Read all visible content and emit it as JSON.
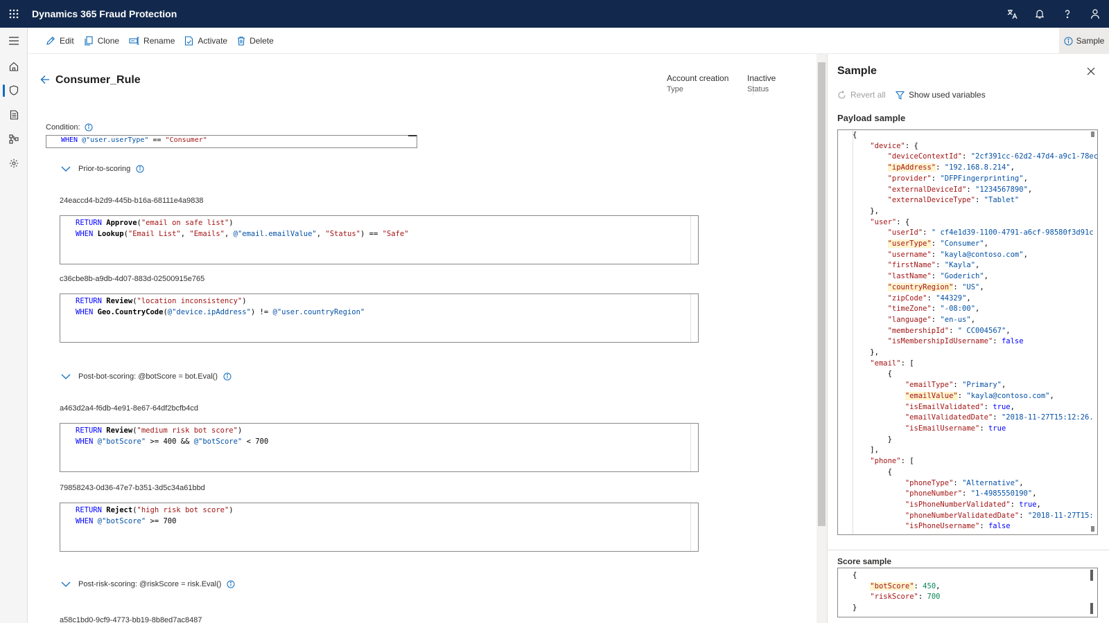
{
  "app": {
    "title": "Dynamics 365 Fraud Protection"
  },
  "topbar": {
    "icons": [
      "waffle-icon",
      "translate-icon",
      "bell-icon",
      "help-icon",
      "person-icon"
    ]
  },
  "leftnav": {
    "icons": [
      "hamburger-icon",
      "home-icon",
      "shield-icon",
      "document-icon",
      "flow-icon",
      "gear-icon"
    ]
  },
  "toolbar": {
    "edit": "Edit",
    "clone": "Clone",
    "rename": "Rename",
    "activate": "Activate",
    "delete": "Delete",
    "sample": "Sample"
  },
  "rule": {
    "name": "Consumer_Rule",
    "type_value": "Account creation",
    "type_label": "Type",
    "status_value": "Inactive",
    "status_label": "Status",
    "condition_label": "Condition:",
    "condition": {
      "kw": "WHEN",
      "var": "@\"user.userType\"",
      "op": " == ",
      "str": "\"Consumer\""
    }
  },
  "sections": [
    {
      "title": "Prior-to-scoring",
      "clauses": [
        {
          "id": "24eaccd4-b2d9-445b-b16a-68111e4a9838",
          "l1": {
            "kw": "RETURN",
            "fn": "Approve",
            "open": "(",
            "str": "\"email on safe list\"",
            "close": ")"
          },
          "l2": {
            "kw": "WHEN",
            "fn": "Lookup",
            "a": "(",
            "s1": "\"Email List\"",
            "c1": ", ",
            "s2": "\"Emails\"",
            "c2": ", ",
            "v1": "@\"email.emailValue\"",
            "c3": ", ",
            "s3": "\"Status\"",
            "c4": ") == ",
            "s4": "\"Safe\""
          }
        },
        {
          "id": "c36cbe8b-a9db-4d07-883d-02500915e765",
          "l1": {
            "kw": "RETURN",
            "fn": "Review",
            "open": "(",
            "str": "\"location inconsistency\"",
            "close": ")"
          },
          "l2": {
            "kw": "WHEN",
            "fn": "Geo.CountryCode",
            "a": "(",
            "v1": "@\"device.ipAddress\"",
            "c1": ") != ",
            "v2": "@\"user.countryRegion\""
          }
        }
      ]
    },
    {
      "title": "Post-bot-scoring: @botScore = bot.Eval()",
      "clauses": [
        {
          "id": "a463d2a4-f6db-4e91-8e67-64df2bcfb4cd",
          "l1": {
            "kw": "RETURN",
            "fn": "Review",
            "open": "(",
            "str": "\"medium risk bot score\"",
            "close": ")"
          },
          "l2": {
            "kw": "WHEN",
            "v1": "@\"botScore\"",
            "c1": " >= 400 && ",
            "v2": "@\"botScore\"",
            "c2": " < 700"
          }
        },
        {
          "id": "79858243-0d36-47e7-b351-3d5c34a61bbd",
          "l1": {
            "kw": "RETURN",
            "fn": "Reject",
            "open": "(",
            "str": "\"high risk bot score\"",
            "close": ")"
          },
          "l2": {
            "kw": "WHEN",
            "v1": "@\"botScore\"",
            "c1": " >= 700"
          }
        }
      ]
    },
    {
      "title": "Post-risk-scoring: @riskScore = risk.Eval()",
      "clauses": [
        {
          "id": "a58c1bd0-9cf9-4773-bb19-8b8ed7ac8487"
        }
      ]
    }
  ],
  "panel": {
    "title": "Sample",
    "revert_all": "Revert all",
    "show_used_variables": "Show used variables",
    "payload_label": "Payload sample",
    "score_label": "Score sample",
    "payload_lines": [
      [
        [
          "p",
          "{"
        ]
      ],
      [
        [
          "p",
          "    "
        ],
        [
          "k",
          "\"device\""
        ],
        [
          "p",
          ": {"
        ]
      ],
      [
        [
          "p",
          "        "
        ],
        [
          "k",
          "\"deviceContextId\""
        ],
        [
          "p",
          ": "
        ],
        [
          "s",
          "\"2cf391cc-62d2-47d4-a9c1-78ec"
        ]
      ],
      [
        [
          "p",
          "        "
        ],
        [
          "k",
          "\"ipAddress\"",
          "hl"
        ],
        [
          "p",
          ": "
        ],
        [
          "s",
          "\"192.168.8.214\""
        ],
        [
          "p",
          ","
        ]
      ],
      [
        [
          "p",
          "        "
        ],
        [
          "k",
          "\"provider\""
        ],
        [
          "p",
          ": "
        ],
        [
          "s",
          "\"DFPFingerprinting\""
        ],
        [
          "p",
          ","
        ]
      ],
      [
        [
          "p",
          "        "
        ],
        [
          "k",
          "\"externalDeviceId\""
        ],
        [
          "p",
          ": "
        ],
        [
          "s",
          "\"1234567890\""
        ],
        [
          "p",
          ","
        ]
      ],
      [
        [
          "p",
          "        "
        ],
        [
          "k",
          "\"externalDeviceType\""
        ],
        [
          "p",
          ": "
        ],
        [
          "s",
          "\"Tablet\""
        ]
      ],
      [
        [
          "p",
          "    },"
        ]
      ],
      [
        [
          "p",
          "    "
        ],
        [
          "k",
          "\"user\""
        ],
        [
          "p",
          ": {"
        ]
      ],
      [
        [
          "p",
          "        "
        ],
        [
          "k",
          "\"userId\""
        ],
        [
          "p",
          ": "
        ],
        [
          "s",
          "\" cf4e1d39-1100-4791-a6cf-98580f3d91c"
        ]
      ],
      [
        [
          "p",
          "        "
        ],
        [
          "k",
          "\"userType\"",
          "hl"
        ],
        [
          "p",
          ": "
        ],
        [
          "s",
          "\"Consumer\""
        ],
        [
          "p",
          ","
        ]
      ],
      [
        [
          "p",
          "        "
        ],
        [
          "k",
          "\"username\""
        ],
        [
          "p",
          ": "
        ],
        [
          "s",
          "\"kayla@contoso.com\""
        ],
        [
          "p",
          ","
        ]
      ],
      [
        [
          "p",
          "        "
        ],
        [
          "k",
          "\"firstName\""
        ],
        [
          "p",
          ": "
        ],
        [
          "s",
          "\"Kayla\""
        ],
        [
          "p",
          ","
        ]
      ],
      [
        [
          "p",
          "        "
        ],
        [
          "k",
          "\"lastName\""
        ],
        [
          "p",
          ": "
        ],
        [
          "s",
          "\"Goderich\""
        ],
        [
          "p",
          ","
        ]
      ],
      [
        [
          "p",
          "        "
        ],
        [
          "k",
          "\"countryRegion\"",
          "hl"
        ],
        [
          "p",
          ": "
        ],
        [
          "s",
          "\"US\""
        ],
        [
          "p",
          ","
        ]
      ],
      [
        [
          "p",
          "        "
        ],
        [
          "k",
          "\"zipCode\""
        ],
        [
          "p",
          ": "
        ],
        [
          "s",
          "\"44329\""
        ],
        [
          "p",
          ","
        ]
      ],
      [
        [
          "p",
          "        "
        ],
        [
          "k",
          "\"timeZone\""
        ],
        [
          "p",
          ": "
        ],
        [
          "s",
          "\"-08:00\""
        ],
        [
          "p",
          ","
        ]
      ],
      [
        [
          "p",
          "        "
        ],
        [
          "k",
          "\"language\""
        ],
        [
          "p",
          ": "
        ],
        [
          "s",
          "\"en-us\""
        ],
        [
          "p",
          ","
        ]
      ],
      [
        [
          "p",
          "        "
        ],
        [
          "k",
          "\"membershipId\""
        ],
        [
          "p",
          ": "
        ],
        [
          "s",
          "\" CC004567\""
        ],
        [
          "p",
          ","
        ]
      ],
      [
        [
          "p",
          "        "
        ],
        [
          "k",
          "\"isMembershipIdUsername\""
        ],
        [
          "p",
          ": "
        ],
        [
          "b",
          "false"
        ]
      ],
      [
        [
          "p",
          "    },"
        ]
      ],
      [
        [
          "p",
          "    "
        ],
        [
          "k",
          "\"email\""
        ],
        [
          "p",
          ": ["
        ]
      ],
      [
        [
          "p",
          "        {"
        ]
      ],
      [
        [
          "p",
          "            "
        ],
        [
          "k",
          "\"emailType\""
        ],
        [
          "p",
          ": "
        ],
        [
          "s",
          "\"Primary\""
        ],
        [
          "p",
          ","
        ]
      ],
      [
        [
          "p",
          "            "
        ],
        [
          "k",
          "\"emailValue\"",
          "hl"
        ],
        [
          "p",
          ": "
        ],
        [
          "s",
          "\"kayla@contoso.com\""
        ],
        [
          "p",
          ","
        ]
      ],
      [
        [
          "p",
          "            "
        ],
        [
          "k",
          "\"isEmailValidated\""
        ],
        [
          "p",
          ": "
        ],
        [
          "b",
          "true"
        ],
        [
          "p",
          ","
        ]
      ],
      [
        [
          "p",
          "            "
        ],
        [
          "k",
          "\"emailValidatedDate\""
        ],
        [
          "p",
          ": "
        ],
        [
          "s",
          "\"2018-11-27T15:12:26."
        ]
      ],
      [
        [
          "p",
          "            "
        ],
        [
          "k",
          "\"isEmailUsername\""
        ],
        [
          "p",
          ": "
        ],
        [
          "b",
          "true"
        ]
      ],
      [
        [
          "p",
          "        }"
        ]
      ],
      [
        [
          "p",
          "    ],"
        ]
      ],
      [
        [
          "p",
          "    "
        ],
        [
          "k",
          "\"phone\""
        ],
        [
          "p",
          ": ["
        ]
      ],
      [
        [
          "p",
          "        {"
        ]
      ],
      [
        [
          "p",
          "            "
        ],
        [
          "k",
          "\"phoneType\""
        ],
        [
          "p",
          ": "
        ],
        [
          "s",
          "\"Alternative\""
        ],
        [
          "p",
          ","
        ]
      ],
      [
        [
          "p",
          "            "
        ],
        [
          "k",
          "\"phoneNumber\""
        ],
        [
          "p",
          ": "
        ],
        [
          "s",
          "\"1-4985550190\""
        ],
        [
          "p",
          ","
        ]
      ],
      [
        [
          "p",
          "            "
        ],
        [
          "k",
          "\"isPhoneNumberValidated\""
        ],
        [
          "p",
          ": "
        ],
        [
          "b",
          "true"
        ],
        [
          "p",
          ","
        ]
      ],
      [
        [
          "p",
          "            "
        ],
        [
          "k",
          "\"phoneNumberValidatedDate\""
        ],
        [
          "p",
          ": "
        ],
        [
          "s",
          "\"2018-11-27T15:"
        ]
      ],
      [
        [
          "p",
          "            "
        ],
        [
          "k",
          "\"isPhoneUsername\""
        ],
        [
          "p",
          ": "
        ],
        [
          "b",
          "false"
        ]
      ]
    ],
    "score_lines": [
      [
        [
          "p",
          "{"
        ]
      ],
      [
        [
          "p",
          "    "
        ],
        [
          "k",
          "\"botScore\"",
          "hl"
        ],
        [
          "p",
          ": "
        ],
        [
          "n",
          "450"
        ],
        [
          "p",
          ","
        ]
      ],
      [
        [
          "p",
          "    "
        ],
        [
          "k",
          "\"riskScore\""
        ],
        [
          "p",
          ": "
        ],
        [
          "n",
          "700"
        ]
      ],
      [
        [
          "p",
          "}"
        ]
      ]
    ]
  }
}
